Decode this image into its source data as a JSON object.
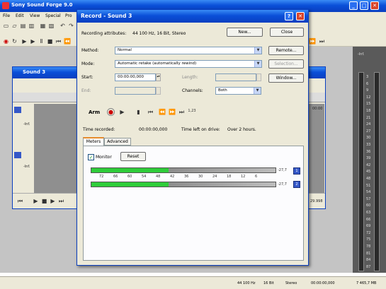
{
  "app": {
    "title": "Sony Sound Forge 9.0",
    "menu": [
      "File",
      "Edit",
      "View",
      "Special",
      "Pro"
    ]
  },
  "snd": {
    "title": "Sound 3",
    "dba": "-Inf.",
    "dbb": "-Inf.",
    "time": "00:00",
    "time2": "29.998"
  },
  "dlg": {
    "title": "Record - Sound 3",
    "attrs_label": "Recording attributes:",
    "attrs_value": "44 100 Hz, 16 Bit, Stereo",
    "new_btn": "New...",
    "close_btn": "Close",
    "method_label": "Method:",
    "method_value": "Normal",
    "mode_label": "Mode:",
    "mode_value": "Automatic retake (automatically rewind)",
    "remote_btn": "Remote...",
    "selection_btn": "Selection...",
    "start_label": "Start:",
    "start_value": "00:00:00,000",
    "length_label": "Length:",
    "end_label": "End:",
    "channels_label": "Channels:",
    "channels_value": "Both",
    "window_btn": "Window...",
    "arm_label": "Arm",
    "time_recorded_label": "Time recorded:",
    "time_recorded_value": "00:00:00,000",
    "time_left_label": "Time left on drive:",
    "time_left_value": "Over 2 hours.",
    "tabs": [
      "Meters",
      "Advanced"
    ],
    "monitor_label": "Monitor",
    "reset_btn": "Reset",
    "scale": [
      "72",
      "66",
      "60",
      "54",
      "48",
      "42",
      "36",
      "30",
      "24",
      "18",
      "12",
      "6"
    ],
    "peak1": "-27,7",
    "peak2": "-27,7",
    "meter_fill": 0.42
  },
  "status": {
    "rate": "44 100 Hz",
    "bits": "16 Bit",
    "chan": "Stereo",
    "len": "00:00:00,000",
    "free": "7 465,7 MB"
  },
  "right_meter": {
    "top": "-Inf.",
    "left": "-Inf.",
    "ticks": [
      "3",
      "6",
      "9",
      "12",
      "15",
      "18",
      "21",
      "24",
      "27",
      "30",
      "33",
      "36",
      "39",
      "42",
      "45",
      "48",
      "51",
      "54",
      "57",
      "60",
      "63",
      "66",
      "69",
      "72",
      "75",
      "78",
      "81",
      "84",
      "87"
    ]
  }
}
